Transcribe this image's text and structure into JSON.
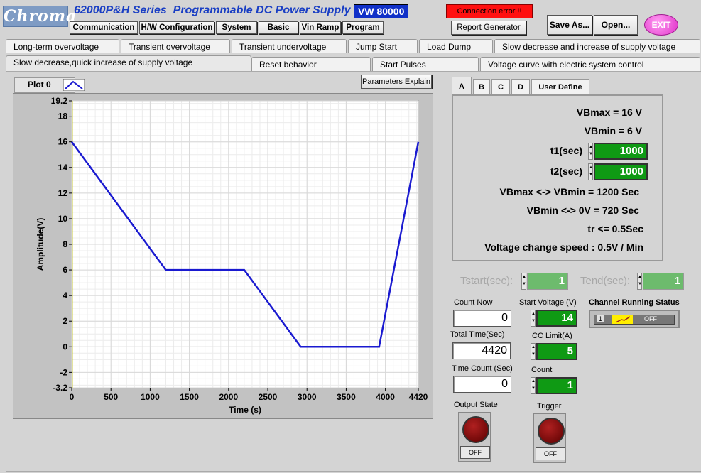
{
  "header": {
    "logo": "Chroma",
    "title": "62000P&H Series  Programmable DC Power Supply",
    "model": "VW 80000",
    "connection_status": "Connection error !!",
    "report_generator": "Report Generator",
    "save_as": "Save As...",
    "open": "Open...",
    "exit": "EXIT"
  },
  "menu": [
    "Communication",
    "H/W Configuration",
    "System",
    "Basic",
    "Vin Ramp",
    "Program"
  ],
  "tabs_row1": [
    "Long-term overvoltage",
    "Transient overvoltage",
    "Transient undervoltage",
    "Jump Start",
    "Load Dump",
    "Slow decrease and increase of supply voltage"
  ],
  "tabs_row2": [
    "Slow decrease,quick increase of supply voltage",
    "Reset behavior",
    "Start Pulses",
    "Voltage curve with electric system control"
  ],
  "plot": {
    "legend_label": "Plot 0",
    "params_button": "Parameters Explain"
  },
  "chart_data": {
    "type": "line",
    "xlabel": "Time (s)",
    "ylabel": "Amplitude(V)",
    "xlim": [
      0,
      4420
    ],
    "ylim": [
      -3.2,
      19.2
    ],
    "x_ticks": [
      "0",
      "500",
      "1000",
      "1500",
      "2000",
      "2500",
      "3000",
      "3500",
      "4000",
      "4420"
    ],
    "y_ticks": [
      "-3.2",
      "-2",
      "0",
      "2",
      "4",
      "6",
      "8",
      "10",
      "12",
      "14",
      "16",
      "18",
      "19.2"
    ],
    "grid": true,
    "series": [
      {
        "x": [
          0,
          1200,
          2200,
          2920,
          3920,
          4420
        ],
        "y": [
          16,
          6,
          6,
          0,
          0,
          16
        ],
        "color": "#1a1ad0"
      }
    ]
  },
  "subtabs": [
    "A",
    "B",
    "C",
    "D",
    "User Define"
  ],
  "info": {
    "vbmax": "VBmax = 16 V",
    "vbmin": "VBmin = 6 V",
    "t1_label": "t1(sec)",
    "t1_value": "1000",
    "t2_label": "t2(sec)",
    "t2_value": "1000",
    "line1": "VBmax <-> VBmin = 1200 Sec",
    "line2": "VBmin <-> 0V = 720 Sec",
    "line3": "tr <= 0.5Sec",
    "line4": "Voltage change speed : 0.5V / Min"
  },
  "tstart": {
    "label": "Tstart(sec):",
    "value": "1"
  },
  "tend": {
    "label": "Tend(sec):",
    "value": "1"
  },
  "status": {
    "count_now_label": "Count Now",
    "count_now": "0",
    "total_time_label": "Total Time(Sec)",
    "total_time": "4420",
    "time_count_label": "Time Count (Sec)",
    "time_count": "0",
    "start_voltage_label": "Start Voltage (V)",
    "start_voltage": "14",
    "cc_limit_label": "CC Limit(A)",
    "cc_limit": "5",
    "count_label": "Count",
    "count": "1",
    "channel_label": "Channel Running Status",
    "channel_num": "1",
    "channel_state": "OFF",
    "output_state_label": "Output State",
    "output_state": "OFF",
    "trigger_label": "Trigger",
    "trigger_state": "OFF"
  }
}
